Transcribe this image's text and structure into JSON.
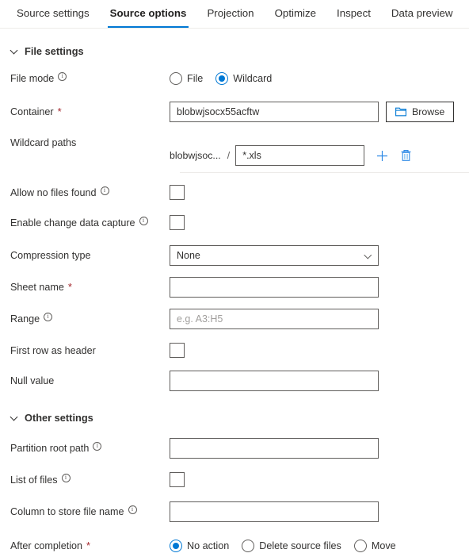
{
  "tabs": [
    {
      "label": "Source settings",
      "active": false
    },
    {
      "label": "Source options",
      "active": true
    },
    {
      "label": "Projection",
      "active": false
    },
    {
      "label": "Optimize",
      "active": false
    },
    {
      "label": "Inspect",
      "active": false
    },
    {
      "label": "Data preview",
      "active": false
    }
  ],
  "colors": {
    "accent": "#0078d4",
    "required_asterisk": "#a4262c",
    "border": "#605e5c",
    "text": "#323130"
  },
  "file_settings": {
    "section_title": "File settings",
    "file_mode": {
      "label": "File mode",
      "options": [
        {
          "label": "File",
          "selected": false
        },
        {
          "label": "Wildcard",
          "selected": true
        }
      ]
    },
    "container": {
      "label": "Container",
      "required_marker": "*",
      "value": "blobwjsocx55acftw",
      "browse_label": "Browse"
    },
    "wildcard_paths": {
      "label": "Wildcard paths",
      "prefix": "blobwjsoc...",
      "separator": "/",
      "value": "*.xls",
      "add_icon": "plus-icon",
      "delete_icon": "trash-icon"
    },
    "allow_no_files_found": {
      "label": "Allow no files found",
      "checked": false
    },
    "enable_change_data_capture": {
      "label": "Enable change data capture",
      "checked": false
    },
    "compression_type": {
      "label": "Compression type",
      "value": "None"
    },
    "sheet_name": {
      "label": "Sheet name",
      "required_marker": "*",
      "value": ""
    },
    "range": {
      "label": "Range",
      "value": "",
      "placeholder": "e.g. A3:H5"
    },
    "first_row_as_header": {
      "label": "First row as header",
      "checked": false
    },
    "null_value": {
      "label": "Null value",
      "value": ""
    }
  },
  "other_settings": {
    "section_title": "Other settings",
    "partition_root_path": {
      "label": "Partition root path",
      "value": ""
    },
    "list_of_files": {
      "label": "List of files",
      "checked": false
    },
    "column_to_store_file_name": {
      "label": "Column to store file name",
      "value": ""
    },
    "after_completion": {
      "label": "After completion",
      "required_marker": "*",
      "options": [
        {
          "label": "No action",
          "selected": true
        },
        {
          "label": "Delete source files",
          "selected": false
        },
        {
          "label": "Move",
          "selected": false
        }
      ]
    }
  }
}
